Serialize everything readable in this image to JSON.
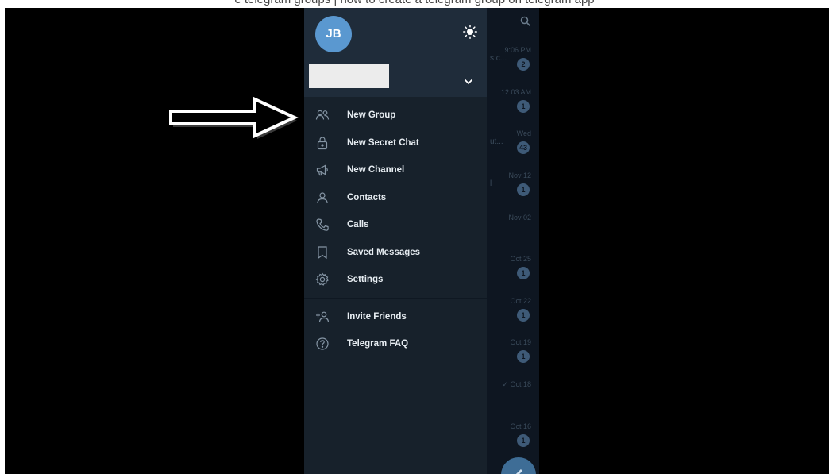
{
  "caption": "e telegram groups | how to create a telegram group on telegram app",
  "drawer": {
    "avatar_initials": "JB",
    "menu_primary": [
      {
        "label": "New Group",
        "icon": "group-icon"
      },
      {
        "label": "New Secret Chat",
        "icon": "lock-icon"
      },
      {
        "label": "New Channel",
        "icon": "megaphone-icon"
      },
      {
        "label": "Contacts",
        "icon": "person-icon"
      },
      {
        "label": "Calls",
        "icon": "phone-icon"
      },
      {
        "label": "Saved Messages",
        "icon": "bookmark-icon"
      },
      {
        "label": "Settings",
        "icon": "gear-icon"
      }
    ],
    "menu_secondary": [
      {
        "label": "Invite Friends",
        "icon": "add-person-icon"
      },
      {
        "label": "Telegram FAQ",
        "icon": "question-icon"
      }
    ]
  },
  "chat_list": [
    {
      "time": "9:06 PM",
      "preview": "s c...",
      "badge": "2"
    },
    {
      "time": "12:03 AM",
      "preview": "",
      "badge": "1"
    },
    {
      "time": "Wed",
      "preview": "ut...",
      "badge": "43"
    },
    {
      "time": "Nov 12",
      "preview": "l",
      "badge": "1"
    },
    {
      "time": "Nov 02",
      "preview": "",
      "badge": ""
    },
    {
      "time": "Oct 25",
      "preview": "",
      "badge": "1"
    },
    {
      "time": "Oct 22",
      "preview": "",
      "badge": "1"
    },
    {
      "time": "Oct 19",
      "preview": "",
      "badge": "1"
    },
    {
      "time": "✓ Oct 18",
      "preview": "",
      "badge": ""
    },
    {
      "time": "Oct 16",
      "preview": "",
      "badge": "1"
    }
  ],
  "colors": {
    "drawer_bg": "#17212b",
    "header_bg": "#1f2c3a",
    "chatlist_bg": "#0e1621",
    "avatar": "#5a98d0",
    "badge": "#3e5a77"
  }
}
